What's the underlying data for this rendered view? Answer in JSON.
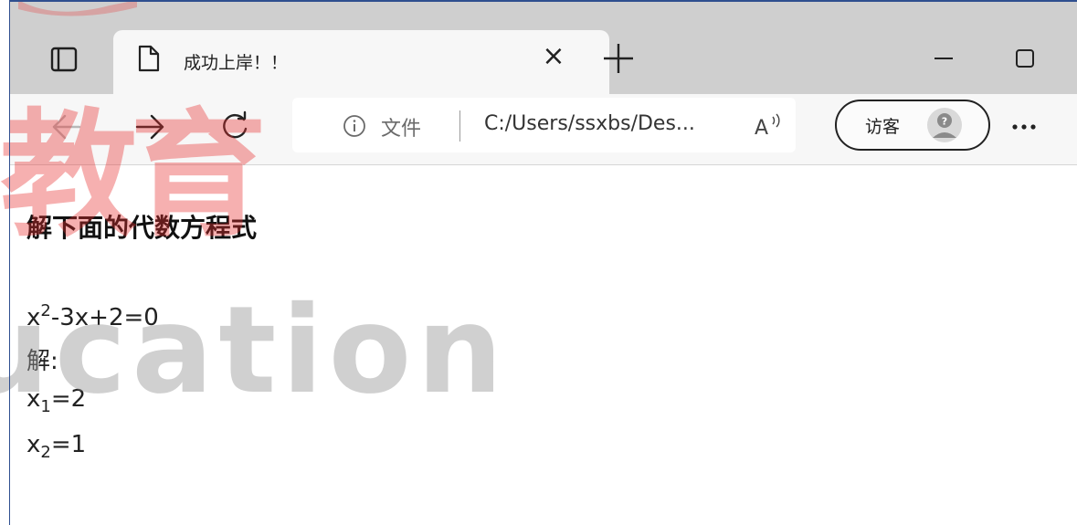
{
  "browser": {
    "tab": {
      "title": "成功上岸！！",
      "close_glyph": "×"
    },
    "address": {
      "site_label": "文件",
      "url": "C:/Users/ssxbs/Des...",
      "read_aloud_icon": "read-aloud-icon"
    },
    "profile": {
      "label": "访客",
      "avatar_icon": "guest-avatar-icon"
    },
    "icons": [
      "tab-switcher-icon",
      "document-icon",
      "close-icon",
      "plus-icon",
      "minimize-icon",
      "maximize-icon",
      "window-close-icon",
      "back-arrow-icon",
      "forward-arrow-icon",
      "refresh-icon",
      "info-icon",
      "more-icon"
    ]
  },
  "page": {
    "heading": "解下面的代数方程式",
    "equation": {
      "base": "x",
      "exponent": "2",
      "rest": "-3x+2=0"
    },
    "solution_label": "解:",
    "solutions": [
      {
        "var": "x",
        "index": "1",
        "value": "=2"
      },
      {
        "var": "x",
        "index": "2",
        "value": "=1"
      }
    ]
  },
  "watermark": {
    "cn_text": "教育",
    "en_text": "ucation"
  },
  "colors": {
    "titlebar_bg": "#cfcfcf",
    "toolbar_bg": "#f7f7f7",
    "tab_bg": "#f7f7f7",
    "watermark_red": "#e83030",
    "watermark_gray": "#969696"
  }
}
